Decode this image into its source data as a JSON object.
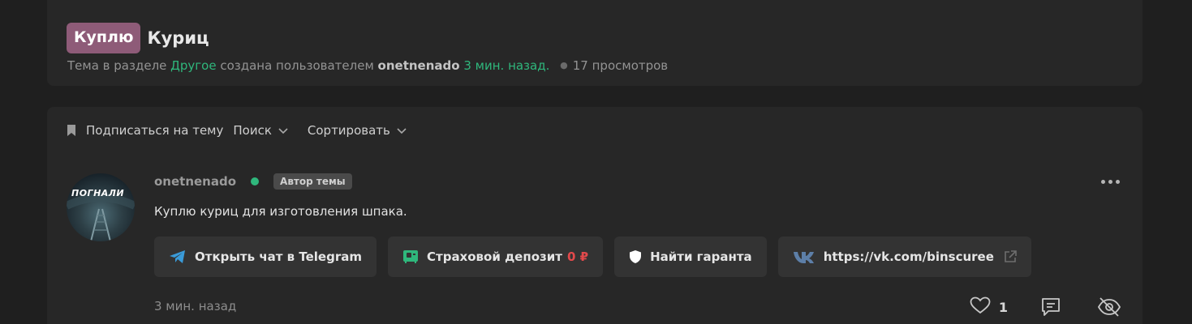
{
  "thread": {
    "prefix": "Куплю",
    "title": "Куриц",
    "meta": {
      "text1": "Тема в разделе ",
      "section": "Другое",
      "text2": " создана пользователем ",
      "author": "onetnenado",
      "time": "3 мин. назад.",
      "views": "17 просмотров"
    }
  },
  "toolbar": {
    "subscribe_label": "Подписаться на тему",
    "search_label": "Поиск",
    "sort_label": "Сортировать"
  },
  "post": {
    "username": "onetnenado",
    "author_badge": "Автор темы",
    "avatar_text": "ПОГНАЛИ",
    "text": "Куплю куриц для изготовления шпака.",
    "buttons": {
      "telegram": "Открыть чат в Telegram",
      "deposit": "Страховой депозит",
      "deposit_value": "0 ₽",
      "guarantor": "Найти гаранта",
      "vk": "https://vk.com/binscuree"
    },
    "time": "3 мин. назад",
    "likes": "1"
  },
  "colors": {
    "accent_green": "#2fb77c",
    "prefix_badge": "#8e5b78",
    "deposit_red": "#e2494b"
  },
  "icons": [
    "bookmark-icon",
    "chevron-down-icon",
    "telegram-icon",
    "deposit-icon",
    "shield-icon",
    "vk-icon",
    "external-link-icon",
    "more-icon",
    "heart-icon",
    "reply-icon",
    "hide-icon"
  ]
}
